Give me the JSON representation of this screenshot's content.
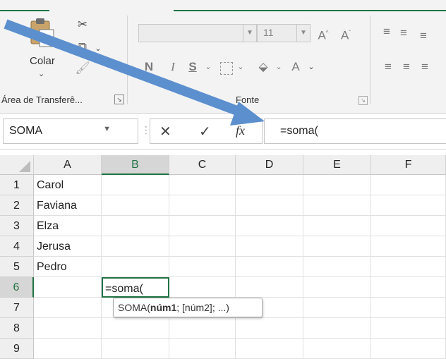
{
  "ribbon": {
    "clipboard": {
      "paste_label": "Colar",
      "group_label": "Área de Transferê...",
      "cut_icon": "scissors-icon",
      "paste_icon": "clipboard-icon",
      "copy_icon": "copy-icon",
      "format_painter_icon": "format-painter-icon"
    },
    "font": {
      "font_name": "",
      "font_size": "11",
      "increase_size": "A",
      "decrease_size": "A",
      "bold": "N",
      "italic": "I",
      "underline": "S",
      "font_color": "A",
      "group_label": "Fonte"
    }
  },
  "formula_bar": {
    "name_box": "SOMA",
    "cancel": "✕",
    "enter": "✓",
    "fx": "fx",
    "value": "=soma("
  },
  "sheet": {
    "columns": [
      "A",
      "B",
      "C",
      "D",
      "E",
      "F"
    ],
    "rows": [
      "1",
      "2",
      "3",
      "4",
      "5",
      "6",
      "7",
      "8",
      "9"
    ],
    "cells": {
      "A1": "Carol",
      "A2": "Faviana",
      "A3": "Elza",
      "A4": "Jerusa",
      "A5": "Pedro",
      "B6": "=soma("
    },
    "active_cell": "B6"
  },
  "tooltip": {
    "func": "SOMA(",
    "arg1": "núm1",
    "rest": "; [núm2]; ...)"
  },
  "colors": {
    "accent": "#217346",
    "arrow": "#5b8fce"
  }
}
